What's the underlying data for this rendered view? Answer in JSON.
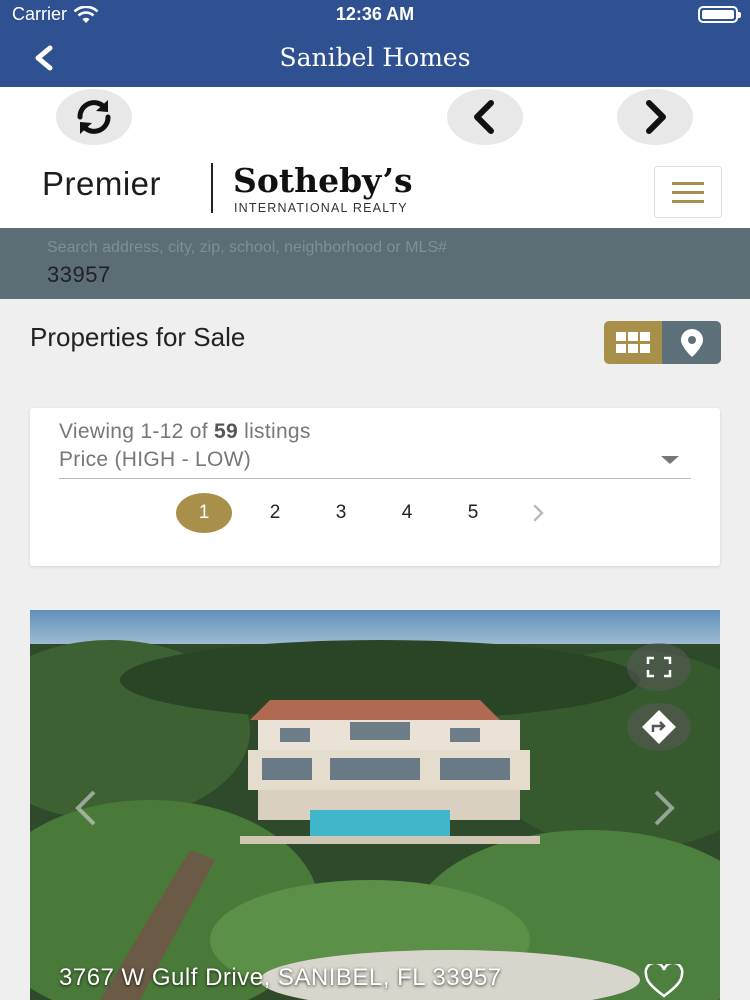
{
  "status_bar": {
    "carrier": "Carrier",
    "time": "12:36 AM"
  },
  "nav": {
    "title": "Sanibel Homes",
    "back_icon": "chevron-left-icon"
  },
  "toolbar": {
    "refresh_icon": "refresh-icon",
    "back_icon": "chevron-left-icon",
    "forward_icon": "chevron-right-icon"
  },
  "brand": {
    "premier": "Premier",
    "sothebys": "Sotheby’s",
    "tagline": "INTERNATIONAL REALTY",
    "accent_color": "#a8904a"
  },
  "search": {
    "placeholder": "Search address, city, zip, school, neighborhood or MLS#",
    "value": "33957"
  },
  "properties": {
    "title": "Properties for Sale",
    "view_grid_icon": "grid-icon",
    "view_map_icon": "map-pin-icon"
  },
  "listings": {
    "viewing_prefix": "Viewing 1-12 of ",
    "total": "59",
    "viewing_suffix": " listings",
    "sort_label": "Price (HIGH - LOW)",
    "pages": [
      "1",
      "2",
      "3",
      "4",
      "5"
    ],
    "current_page": "1"
  },
  "property": {
    "address": "3767 W Gulf Drive, SANIBEL, FL 33957",
    "fullscreen_icon": "fullscreen-icon",
    "directions_icon": "directions-icon",
    "favorite_icon": "heart-icon"
  },
  "colors": {
    "nav_bg": "#2f5192",
    "search_bg": "#5c6d76",
    "gold": "#a8904a"
  }
}
